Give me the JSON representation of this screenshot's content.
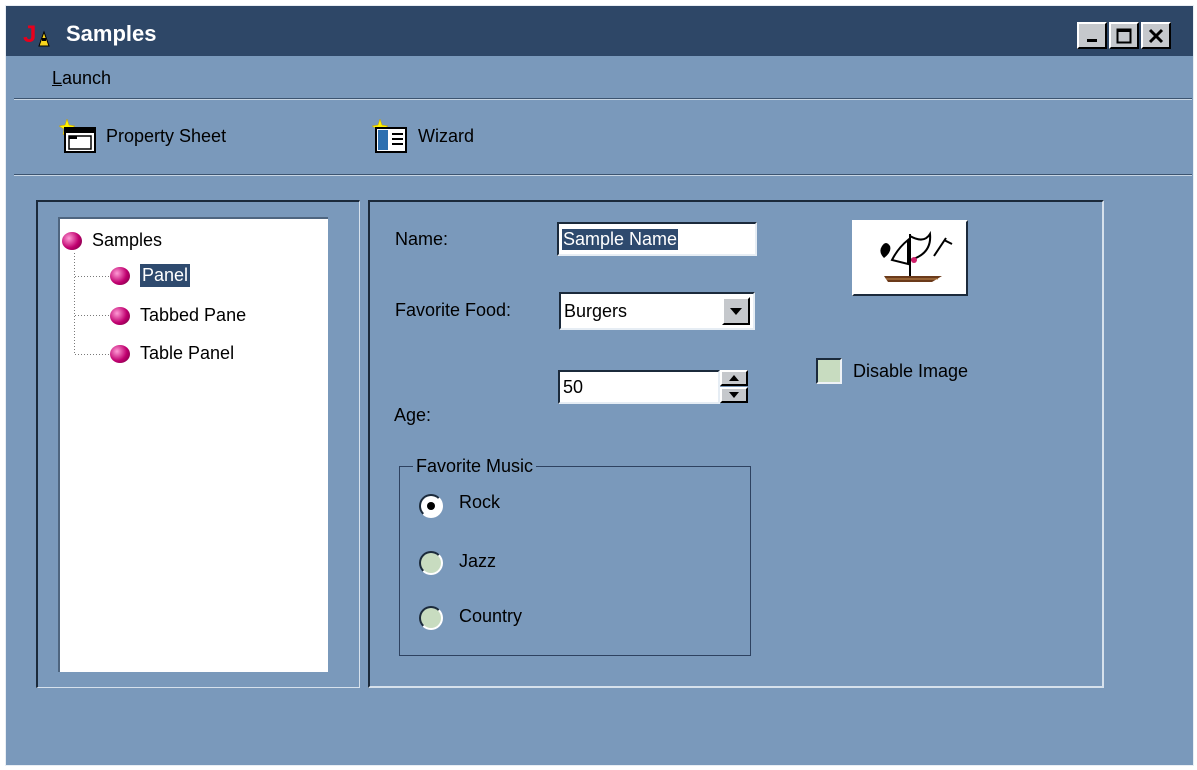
{
  "window": {
    "title": "Samples"
  },
  "menubar": {
    "items": [
      {
        "mnemonic": "L",
        "rest": "aunch"
      }
    ]
  },
  "toolbar": {
    "property_sheet_label": "Property Sheet",
    "wizard_label": "Wizard"
  },
  "tree": {
    "root": "Samples",
    "children": [
      "Panel",
      "Tabbed Pane",
      "Table Panel"
    ],
    "selected": "Panel"
  },
  "form": {
    "name_label": "Name:",
    "name_value": "Sample Name",
    "food_label": "Favorite Food:",
    "food_value": "Burgers",
    "age_label": "Age:",
    "age_value": "50",
    "disable_image_label": "Disable Image",
    "disable_image_checked": false,
    "music_group_label": "Favorite Music",
    "music_options": [
      "Rock",
      "Jazz",
      "Country"
    ],
    "music_selected": "Rock"
  }
}
